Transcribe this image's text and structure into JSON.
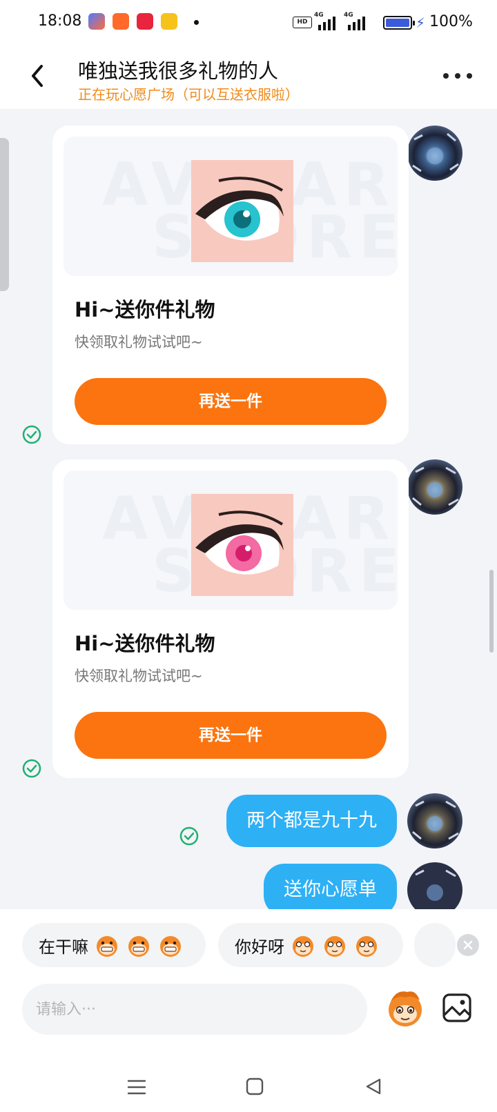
{
  "status_bar": {
    "time": "18:08",
    "hd_label": "HD",
    "network_1": "4G",
    "network_2": "4G",
    "battery_level": 1.0,
    "battery_percent": "100%"
  },
  "header": {
    "title": "唯独送我很多礼物的人",
    "subtitle": "正在玩心愿广场（可以互送衣服啦）",
    "back_icon": "chevron-left-icon",
    "more_icon": "more-horizontal-icon"
  },
  "gift_cards": [
    {
      "watermark_top": "AVATAR",
      "watermark_bottom": "STORE",
      "item": "eye-blue",
      "title": "Hi~送你件礼物",
      "desc": "快领取礼物试试吧~",
      "button_label": "再送一件",
      "status_icon": "check-circle-icon"
    },
    {
      "watermark_top": "AVATAR",
      "watermark_bottom": "STORE",
      "item": "eye-pink",
      "title": "Hi~送你件礼物",
      "desc": "快领取礼物试试吧~",
      "button_label": "再送一件",
      "status_icon": "check-circle-icon"
    }
  ],
  "messages": [
    {
      "text": "两个都是九十九",
      "status_icon": "check-circle-icon"
    },
    {
      "text": "送你心愿单"
    }
  ],
  "quick_replies": [
    {
      "label": "在干嘛",
      "emoji": "grinning-monkey-icon"
    },
    {
      "label": "你好呀",
      "emoji": "smiling-monkey-icon"
    }
  ],
  "input": {
    "placeholder": "请输入···",
    "value": ""
  },
  "colors": {
    "accent": "#fb740f",
    "subtitle": "#f08a16",
    "bubble": "#2eb0f5",
    "check": "#20b070"
  }
}
